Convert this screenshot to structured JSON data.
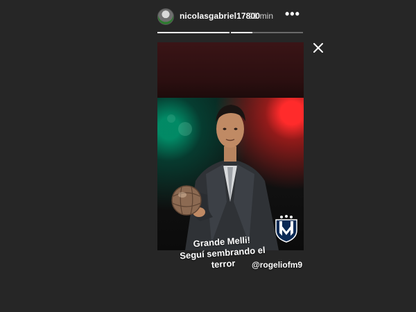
{
  "story": {
    "username": "nicolasgabriel17800",
    "time": "21 min",
    "more_icon": "more-horizontal-icon",
    "close_icon": "close-icon",
    "progress": [
      1.0,
      0.3
    ]
  },
  "overlay": {
    "caption_line1": "Grande Melli!",
    "caption_line2": "Seguí sembrando el",
    "caption_line3": "terror",
    "mention": "@rogeliofm9"
  },
  "colors": {
    "page_bg": "#262626",
    "progress_fill": "#ffffff",
    "progress_track": "#6a6a6a",
    "accent_red": "#ff2b2b",
    "accent_green": "#00966e",
    "crest_blue": "#0b2a55"
  }
}
